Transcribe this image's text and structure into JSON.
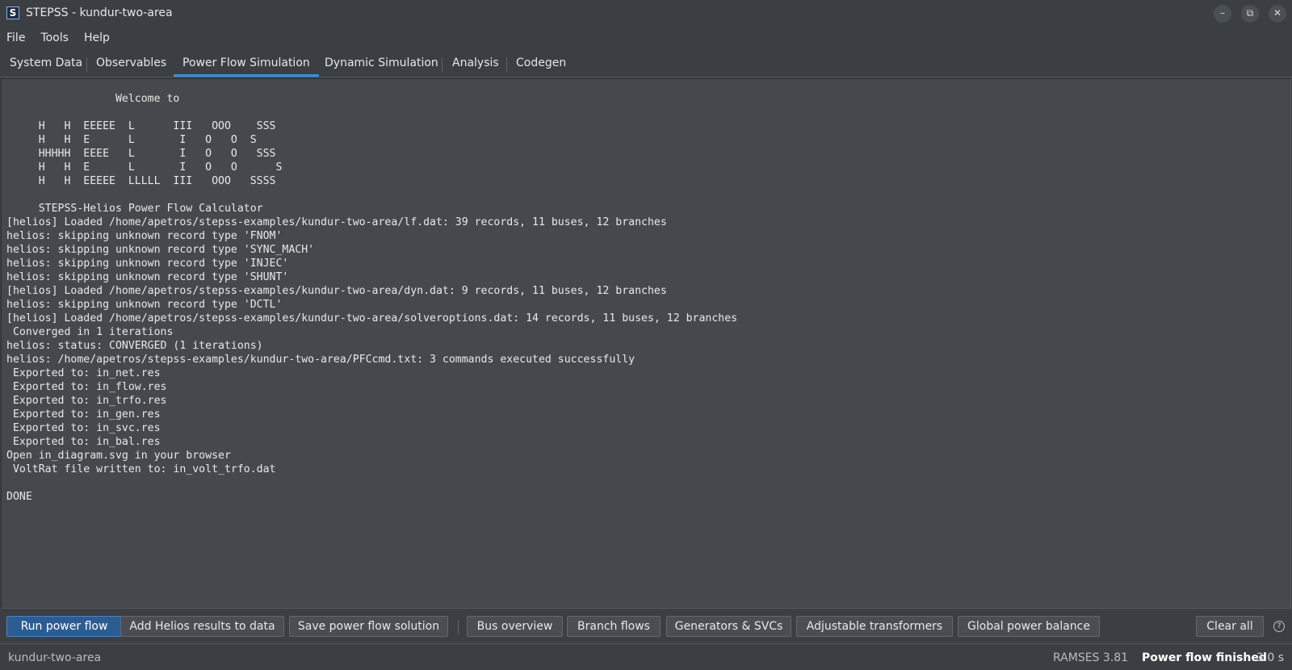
{
  "window": {
    "title": "STEPSS - kundur-two-area",
    "app_icon": "S",
    "controls": {
      "minimize": "–",
      "restore": "⧉",
      "close": "✕"
    }
  },
  "menu": [
    "File",
    "Tools",
    "Help"
  ],
  "tabs": [
    "System Data",
    "Observables",
    "Power Flow Simulation",
    "Dynamic Simulation",
    "Analysis",
    "Codegen"
  ],
  "active_tab": "Power Flow Simulation",
  "console": {
    "lines": [
      "                 Welcome to",
      "",
      "     H   H  EEEEE  L      III   OOO    SSS",
      "     H   H  E      L       I   O   O  S",
      "     HHHHH  EEEE   L       I   O   O   SSS",
      "     H   H  E      L       I   O   O      S",
      "     H   H  EEEEE  LLLLL  III   OOO   SSSS",
      "",
      "     STEPSS-Helios Power Flow Calculator",
      "[helios] Loaded /home/apetros/stepss-examples/kundur-two-area/lf.dat: 39 records, 11 buses, 12 branches",
      "helios: skipping unknown record type 'FNOM'",
      "helios: skipping unknown record type 'SYNC_MACH'",
      "helios: skipping unknown record type 'INJEC'",
      "helios: skipping unknown record type 'SHUNT'",
      "[helios] Loaded /home/apetros/stepss-examples/kundur-two-area/dyn.dat: 9 records, 11 buses, 12 branches",
      "helios: skipping unknown record type 'DCTL'",
      "[helios] Loaded /home/apetros/stepss-examples/kundur-two-area/solveroptions.dat: 14 records, 11 buses, 12 branches",
      " Converged in 1 iterations",
      "helios: status: CONVERGED (1 iterations)",
      "helios: /home/apetros/stepss-examples/kundur-two-area/PFCcmd.txt: 3 commands executed successfully",
      " Exported to: in_net.res",
      " Exported to: in_flow.res",
      " Exported to: in_trfo.res",
      " Exported to: in_gen.res",
      " Exported to: in_svc.res",
      " Exported to: in_bal.res",
      "Open in_diagram.svg in your browser",
      " VoltRat file written to: in_volt_trfo.dat",
      "",
      "DONE"
    ]
  },
  "buttons": {
    "run": "Run power flow",
    "add_results": "Add Helios results to data",
    "save": "Save power flow solution",
    "bus_overview": "Bus overview",
    "branch_flows": "Branch flows",
    "generators": "Generators & SVCs",
    "transformers": "Adjustable transformers",
    "balance": "Global power balance",
    "clear": "Clear all",
    "help": "?"
  },
  "status": {
    "project": "kundur-two-area",
    "version": "RAMSES 3.81",
    "state": "Power flow finished",
    "time": "3.0 s"
  },
  "colors": {
    "background": "#3b3f44",
    "console_bg": "#45494d",
    "accent": "#3d8fd6",
    "primary_button": "#2d5c93"
  }
}
